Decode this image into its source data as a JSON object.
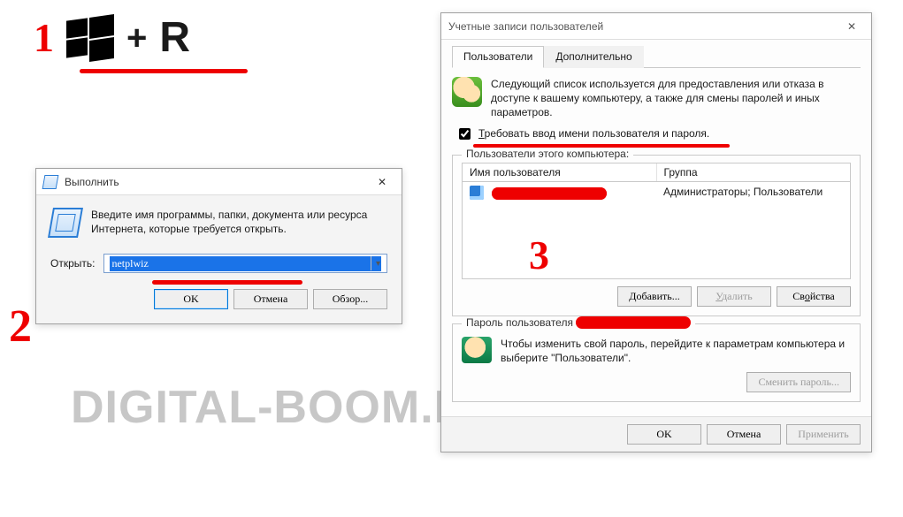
{
  "annotations": {
    "step1": "1",
    "plus": "+",
    "rkey": "R",
    "step2": "2",
    "step3": "3"
  },
  "watermark": "DIGITAL-BOOM.RU",
  "runDialog": {
    "title": "Выполнить",
    "close": "✕",
    "instruction": "Введите имя программы, папки, документа или ресурса Интернета, которые требуется открыть.",
    "openLabel": "Открыть:",
    "openValue": "netplwiz",
    "ok": "OK",
    "cancel": "Отмена",
    "browse": "Обзор..."
  },
  "userAccounts": {
    "title": "Учетные записи пользователей",
    "close": "✕",
    "tabs": {
      "users": "Пользователи",
      "advanced": "Дополнительно"
    },
    "intro": "Следующий список используется для предоставления или отказа в доступе к вашему компьютеру, а также для смены паролей и иных параметров.",
    "requireLabelPrefix": "Т",
    "requireLabelRest": "ребовать ввод имени пользователя и пароля.",
    "requireChecked": true,
    "listLegend": "Пользователи этого компьютера:",
    "col1": "Имя пользователя",
    "col2": "Группа",
    "row1group": "Администраторы; Пользователи",
    "add": "Добавить...",
    "addKey": "Д",
    "remove": "Удалить",
    "removeKey": "У",
    "props": "Свойства",
    "propsKey": "о",
    "pwLegend": "Пароль пользователя",
    "pwText": "Чтобы изменить свой пароль, перейдите к параметрам компьютера и выберите \"Пользователи\".",
    "changePw": "Сменить пароль...",
    "ok": "OK",
    "cancel": "Отмена",
    "apply": "Применить"
  }
}
